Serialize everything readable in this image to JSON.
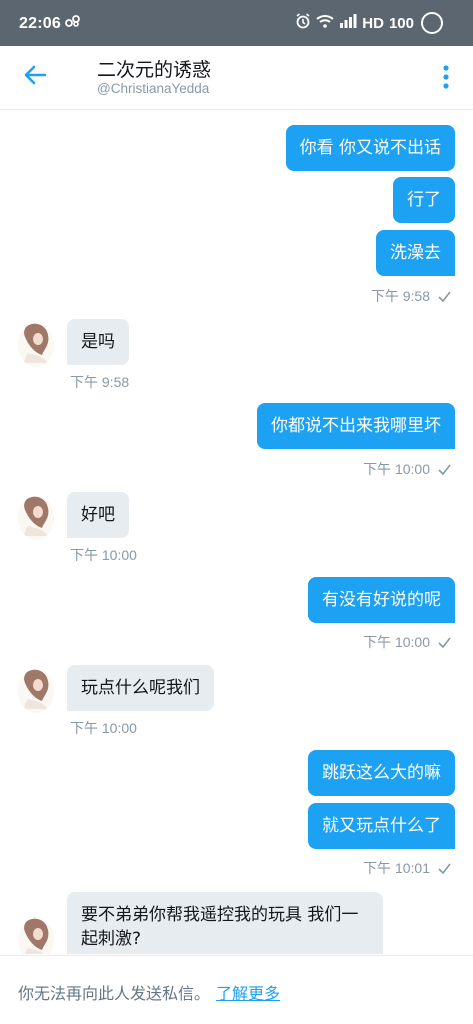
{
  "status_bar": {
    "time": "22:06",
    "hd_label": "HD",
    "battery": "100",
    "icons": [
      "network-activity-icon",
      "alarm-icon",
      "wifi-icon",
      "signal-icon",
      "battery-ring-icon"
    ]
  },
  "header": {
    "title": "二次元的诱惑",
    "handle": "@ChristianaYedda",
    "back_icon": "arrow-left-icon",
    "more_icon": "more-vertical-icon",
    "accent": "#1da1f2"
  },
  "messages": [
    {
      "dir": "out",
      "text": "你看  你又说不出话"
    },
    {
      "dir": "out",
      "text": "行了"
    },
    {
      "dir": "out",
      "text": "洗澡去",
      "time": "下午 9:58"
    },
    {
      "dir": "in",
      "text": "是吗",
      "time": "下午 9:58"
    },
    {
      "dir": "out",
      "text": "你都说不出来我哪里坏",
      "time": "下午 10:00"
    },
    {
      "dir": "in",
      "text": "好吧",
      "time": "下午 10:00"
    },
    {
      "dir": "out",
      "text": "有没有好说的呢",
      "time": "下午 10:00"
    },
    {
      "dir": "in",
      "text": "玩点什么呢我们",
      "time": "下午 10:00"
    },
    {
      "dir": "out",
      "text": "跳跃这么大的嘛"
    },
    {
      "dir": "out",
      "text": "就又玩点什么了",
      "time": "下午 10:01"
    },
    {
      "dir": "in",
      "text": "要不弟弟你帮我遥控我的玩具 我们一起刺激?"
    }
  ],
  "footer": {
    "notice": "你无法再向此人发送私信。",
    "link": "了解更多"
  },
  "colors": {
    "outgoing_bubble": "#1da1f2",
    "incoming_bubble": "#e6ecf0",
    "meta_text": "#8899a6",
    "status_bar": "#5c6670"
  }
}
